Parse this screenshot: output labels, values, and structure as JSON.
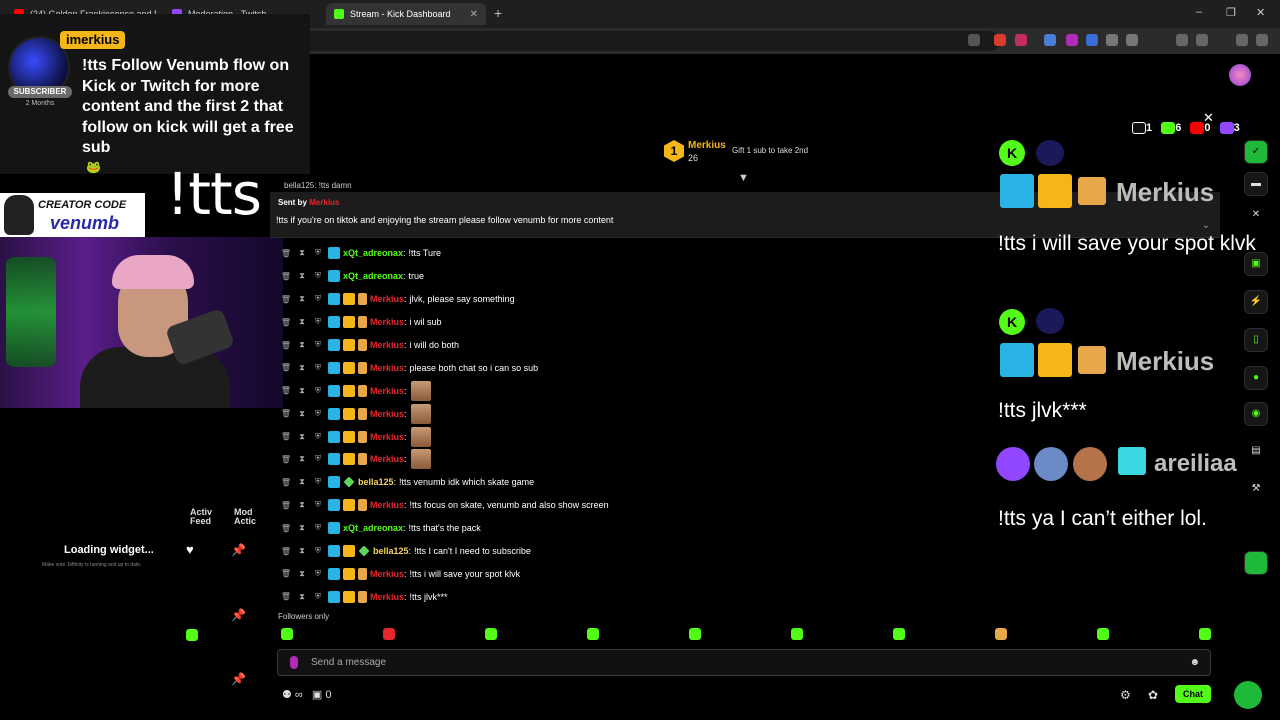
{
  "browser": {
    "tabs": [
      {
        "label": "(24) Golden Frankincense and M",
        "icon": "youtube-icon",
        "color": "#ff0000"
      },
      {
        "label": "Moderation - Twitch",
        "icon": "twitch-icon",
        "color": "#9146ff"
      },
      {
        "label": "Stream - Kick Dashboard",
        "icon": "kick-icon",
        "color": "#53fc18",
        "active": true
      }
    ],
    "new_tab": "+",
    "window_controls": [
      "–",
      "❐",
      "✕"
    ]
  },
  "tts_alert": {
    "username": "imerkius",
    "badge": "SUBSCRIBER",
    "months": "2 Months",
    "message": "!tts Follow Venumb flow on Kick or Twitch for more content and the first 2 that follow on kick will get a free sub"
  },
  "big_text": "!tts",
  "creator_code": {
    "line1": "CREATOR CODE",
    "line2": "venumb"
  },
  "widgets": {
    "activity_feed": "Activ\nFeed",
    "mod_actions": "Mod\nActic",
    "loading": "Loading widget...",
    "loading_sub": "Make sure 1kffinity is running and up to date."
  },
  "leaderboard": {
    "rank": "1",
    "name": "Merkius",
    "count": "26",
    "gift_text": "Gift 1 sub to take 2nd"
  },
  "pinned": {
    "sent_by_label": "Sent by",
    "sent_by_name": "Merkius",
    "message": "!tts if you're on tiktok and enjoying the stream please follow venumb for more content",
    "top_strip": "bella125: !tts damn"
  },
  "chat": [
    {
      "user": "xQt_adreonax",
      "color": "green",
      "badges": [
        "mod"
      ],
      "text": "!tts Ture"
    },
    {
      "user": "xQt_adreonax",
      "color": "green",
      "badges": [
        "mod"
      ],
      "text": "true"
    },
    {
      "user": "Merkius",
      "color": "red",
      "badges": [
        "mod",
        "crown",
        "gift"
      ],
      "text": "jlvk, please say something"
    },
    {
      "user": "Merkius",
      "color": "red",
      "badges": [
        "mod",
        "crown",
        "gift"
      ],
      "text": "i wil sub"
    },
    {
      "user": "Merkius",
      "color": "red",
      "badges": [
        "mod",
        "crown",
        "gift"
      ],
      "text": "i will do both"
    },
    {
      "user": "Merkius",
      "color": "red",
      "badges": [
        "mod",
        "crown",
        "gift"
      ],
      "text": "please both chat so i can so sub"
    },
    {
      "user": "Merkius",
      "color": "red",
      "badges": [
        "mod",
        "crown",
        "gift"
      ],
      "text": "",
      "emote": true
    },
    {
      "user": "Merkius",
      "color": "red",
      "badges": [
        "mod",
        "crown",
        "gift"
      ],
      "text": "",
      "emote": true
    },
    {
      "user": "Merkius",
      "color": "red",
      "badges": [
        "mod",
        "crown",
        "gift"
      ],
      "text": "",
      "emote": true
    },
    {
      "user": "Merkius",
      "color": "red",
      "badges": [
        "mod",
        "crown",
        "gift"
      ],
      "text": "",
      "emote": true
    },
    {
      "user": "bella125",
      "color": "yellow",
      "badges": [
        "mod",
        "sub"
      ],
      "text": "!tts venumb idk which skate game"
    },
    {
      "user": "Merkius",
      "color": "red",
      "badges": [
        "mod",
        "crown",
        "gift"
      ],
      "text": "!tts focus on skate, venumb and also show screen"
    },
    {
      "user": "xQt_adreonax",
      "color": "green",
      "badges": [
        "mod"
      ],
      "text": "!tts that's the pack"
    },
    {
      "user": "bella125",
      "color": "yellow",
      "badges": [
        "mod",
        "crown",
        "sub"
      ],
      "text": "!tts I can't I need to subscribe"
    },
    {
      "user": "Merkius",
      "color": "red",
      "badges": [
        "mod",
        "crown",
        "gift"
      ],
      "text": "!tts i will save your spot klvk"
    },
    {
      "user": "Merkius",
      "color": "red",
      "badges": [
        "mod",
        "crown",
        "gift"
      ],
      "text": "!tts jlvk***"
    }
  ],
  "followers_only": "Followers only",
  "message_placeholder": "Send a message",
  "bottom_left_count": "0",
  "chat_button": "Chat",
  "platform_counts": {
    "tiktok": "1",
    "kick": "6",
    "youtube": "0",
    "twitch": "3"
  },
  "overlay_messages": [
    {
      "name": "Merkius",
      "text": "!tts i will save your spot klvk"
    },
    {
      "name": "Merkius",
      "text": "!tts jlvk***"
    },
    {
      "name": "areiliaa",
      "text": "!tts ya I can’t either lol."
    }
  ],
  "colors": {
    "kick_green": "#53fc18",
    "merkius_red": "#e4272c",
    "gold": "#f4b619",
    "mod_blue": "#2ab4e6"
  }
}
